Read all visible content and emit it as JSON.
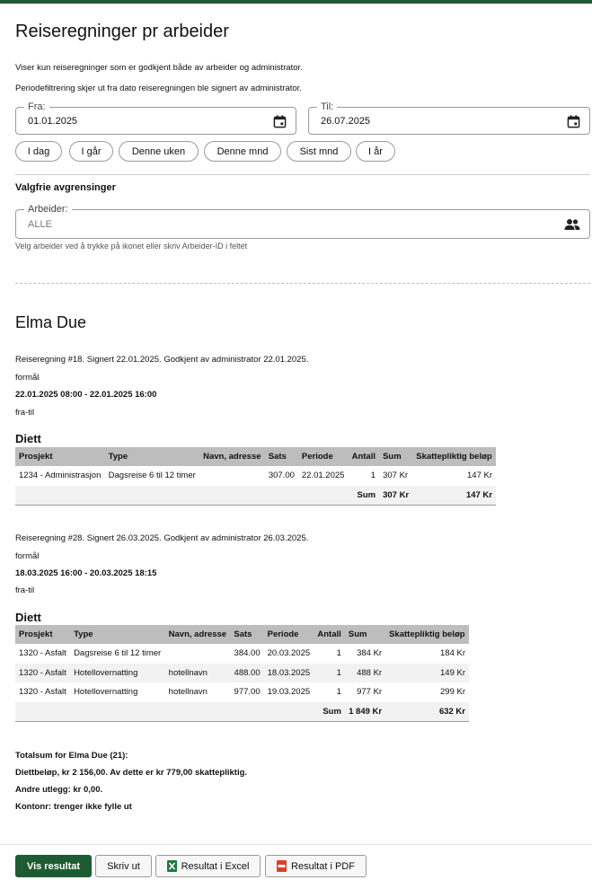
{
  "page": {
    "title": "Reiseregninger pr arbeider",
    "info1": "Viser kun reiseregninger som er godkjent både av arbeider og administrator.",
    "info2": "Periodefiltrering skjer ut fra dato reiseregningen ble signert av administrator."
  },
  "filters": {
    "from_label": "Fra:",
    "from_value": "01.01.2025",
    "to_label": "Til:",
    "to_value": "26.07.2025",
    "quick": [
      "I dag",
      "I går",
      "Denne uken",
      "Denne mnd",
      "Sist mnd",
      "I år"
    ],
    "optional_heading": "Valgfrie avgrensinger",
    "worker_label": "Arbeider:",
    "worker_placeholder": "ALLE",
    "worker_help": "Velg arbeider ved å trykke på ikonet eller skriv Arbeider-ID i feltet"
  },
  "worker": {
    "name": "Elma Due",
    "claims": [
      {
        "header": "Reiseregning #18. Signert 22.01.2025. Godkjent av administrator 22.01.2025.",
        "purpose": "formål",
        "period": "22.01.2025 08:00 - 22.01.2025 16:00",
        "route": "fra-til",
        "section": "Diett",
        "columns": [
          "Prosjekt",
          "Type",
          "Navn, adresse",
          "Sats",
          "Periode",
          "Antall",
          "Sum",
          "Skattepliktig beløp"
        ],
        "rows": [
          [
            "1234 - Administrasjon",
            "Dagsreise 6 til 12 timer",
            "",
            "307.00",
            "22.01.2025",
            "1",
            "307 Kr",
            "147 Kr"
          ]
        ],
        "sum_label": "Sum",
        "sum_value": "307 Kr",
        "sum_taxable": "147 Kr"
      },
      {
        "header": "Reiseregning #28. Signert 26.03.2025. Godkjent av administrator 26.03.2025.",
        "purpose": "formål",
        "period": "18.03.2025 16:00 - 20.03.2025 18:15",
        "route": "fra-til",
        "section": "Diett",
        "columns": [
          "Prosjekt",
          "Type",
          "Navn, adresse",
          "Sats",
          "Periode",
          "Antall",
          "Sum",
          "Skattepliktig beløp"
        ],
        "rows": [
          [
            "1320 - Asfalt",
            "Dagsreise 6 til 12 timer",
            "",
            "384.00",
            "20.03.2025",
            "1",
            "384 Kr",
            "184 Kr"
          ],
          [
            "1320 - Asfalt",
            "Hotellovernatting",
            "hotellnavn",
            "488.00",
            "18.03.2025",
            "1",
            "488 Kr",
            "149 Kr"
          ],
          [
            "1320 - Asfalt",
            "Hotellovernatting",
            "hotellnavn",
            "977.00",
            "19.03.2025",
            "1",
            "977 Kr",
            "299 Kr"
          ]
        ],
        "sum_label": "Sum",
        "sum_value": "1 849 Kr",
        "sum_taxable": "632 Kr"
      }
    ],
    "totals": [
      "Totalsum for Elma Due (21):",
      "Diettbeløp, kr 2 156,00. Av dette er kr 779,00 skattepliktig.",
      "Andre utlegg: kr 0,00.",
      "Kontonr: trenger ikke fylle ut"
    ]
  },
  "actions": {
    "show": "Vis resultat",
    "print": "Skriv ut",
    "excel": "Resultat i Excel",
    "pdf": "Resultat i PDF"
  },
  "colors": {
    "accent": "#1e5b33",
    "excel": "#1d7a3e",
    "pdf": "#d9412b"
  },
  "icons": {
    "date": "calendar-icon",
    "worker": "people-icon",
    "excel": "excel-file-icon",
    "pdf": "pdf-file-icon"
  }
}
